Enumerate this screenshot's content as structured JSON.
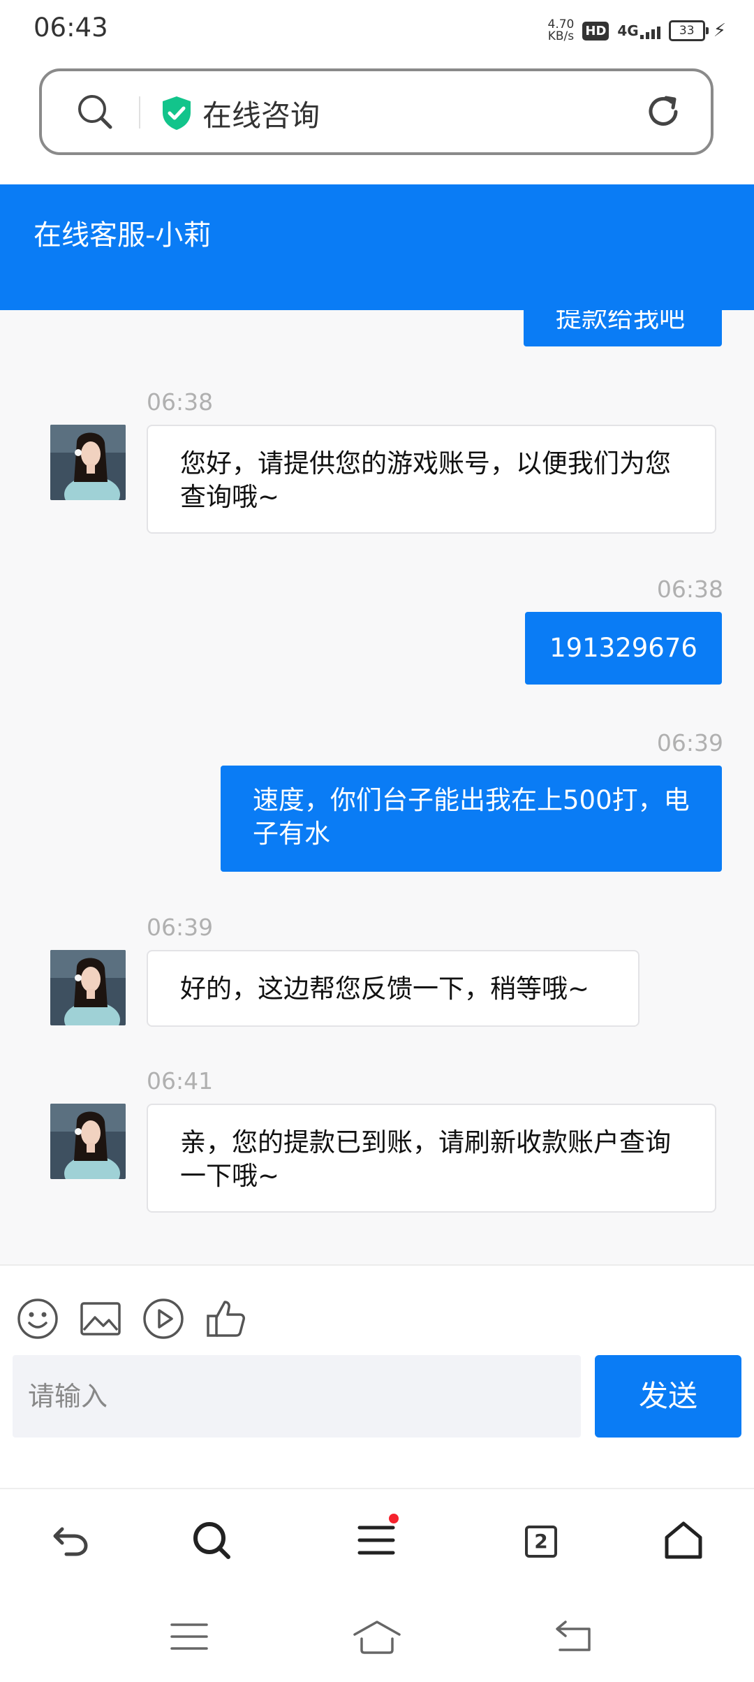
{
  "status_bar": {
    "time": "06:43",
    "speed_value": "4.70",
    "speed_unit": "KB/s",
    "hd_badge": "HD",
    "network": "4G",
    "battery": "33"
  },
  "url_bar": {
    "title": "在线咨询"
  },
  "chat": {
    "header_title": "在线客服-小莉",
    "partial_message": "提款给我吧",
    "messages": [
      {
        "time": "06:38",
        "text": "您好，请提供您的游戏账号，以便我们为您查询哦~"
      },
      {
        "time": "06:38",
        "text": "191329676"
      },
      {
        "time": "06:39",
        "text": "速度，你们台子能出我在上500打，电子有水"
      },
      {
        "time": "06:39",
        "text": "好的，这边帮您反馈一下，稍等哦~"
      },
      {
        "time": "06:41",
        "text": "亲，您的提款已到账，请刷新收款账户查询一下哦~"
      }
    ]
  },
  "composer": {
    "placeholder": "请输入",
    "send_label": "发送"
  },
  "browser_nav": {
    "tab_count": "2"
  },
  "colors": {
    "accent": "#0a7cf5",
    "chat_background": "#f8f8f9",
    "notification_dot": "#f5222d"
  }
}
